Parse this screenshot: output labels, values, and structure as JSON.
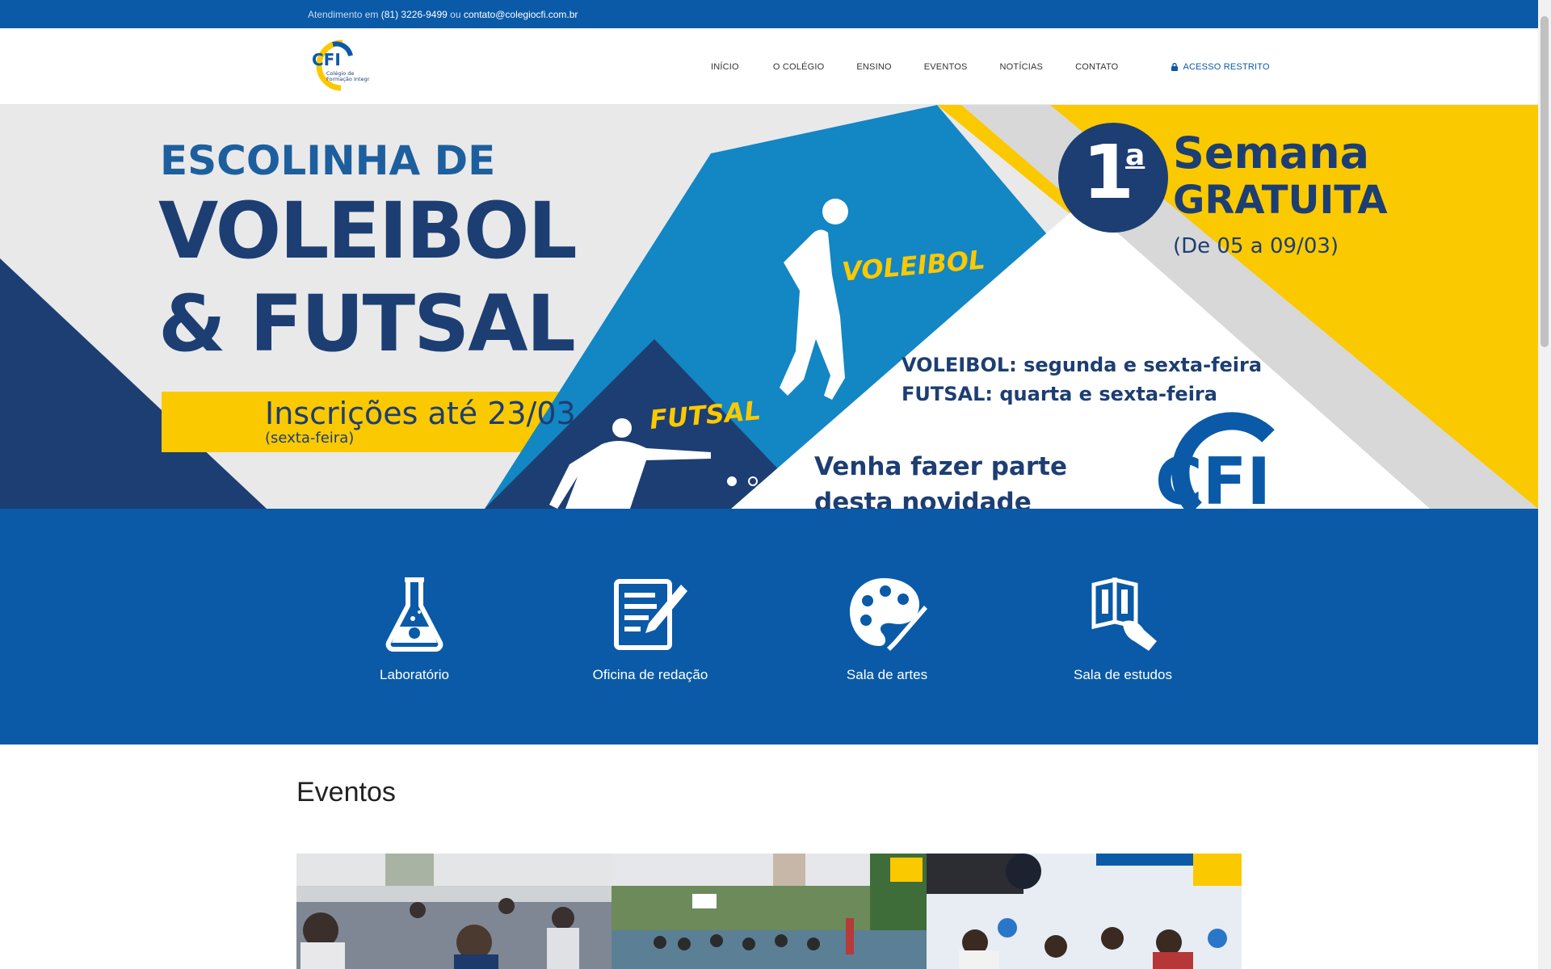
{
  "topbar": {
    "prefix": "Atendimento em",
    "phone": "(81) 3226-9499",
    "or": "ou",
    "email": "contato@colegiocfi.com.br"
  },
  "logo": {
    "letters": "CFI",
    "line1": "Colégio de",
    "line2": "Formação Integral"
  },
  "menu": {
    "items": [
      "INÍCIO",
      "O COLÉGIO",
      "ENSINO",
      "EVENTOS",
      "NOTÍCIAS",
      "CONTATO"
    ],
    "restrito": "ACESSO RESTRITO"
  },
  "hero": {
    "line1": "ESCOLINHA DE",
    "line2": "VOLEIBOL",
    "line3": "& FUTSAL",
    "inscricoes": "Inscrições até 23/03",
    "sexta": "(sexta-feira)",
    "voleibol_tag": "VOLEIBOL",
    "futsal_tag": "FUTSAL",
    "badge_num": "1",
    "badge_sup": "a",
    "semana": "Semana",
    "gratuita": "GRATUITA",
    "datas": "(De 05 a 09/03)",
    "sched1": "VOLEIBOL: segunda e sexta-feira",
    "sched2": "FUTSAL: quarta e sexta-feira",
    "venha1": "Venha fazer parte",
    "venha2": "desta novidade",
    "logo_text": "CFI",
    "slide_count": 2,
    "active_slide": 1
  },
  "features": [
    {
      "label": "Laboratório",
      "icon": "flask-icon"
    },
    {
      "label": "Oficina de redação",
      "icon": "writing-icon"
    },
    {
      "label": "Sala de artes",
      "icon": "palette-icon"
    },
    {
      "label": "Sala de estudos",
      "icon": "books-icon"
    }
  ],
  "eventos": {
    "title": "Eventos"
  },
  "colors": {
    "primary_blue": "#0a5aa8",
    "dark_blue": "#1d3e72",
    "yellow": "#fbc900",
    "mid_blue": "#1386c4"
  }
}
